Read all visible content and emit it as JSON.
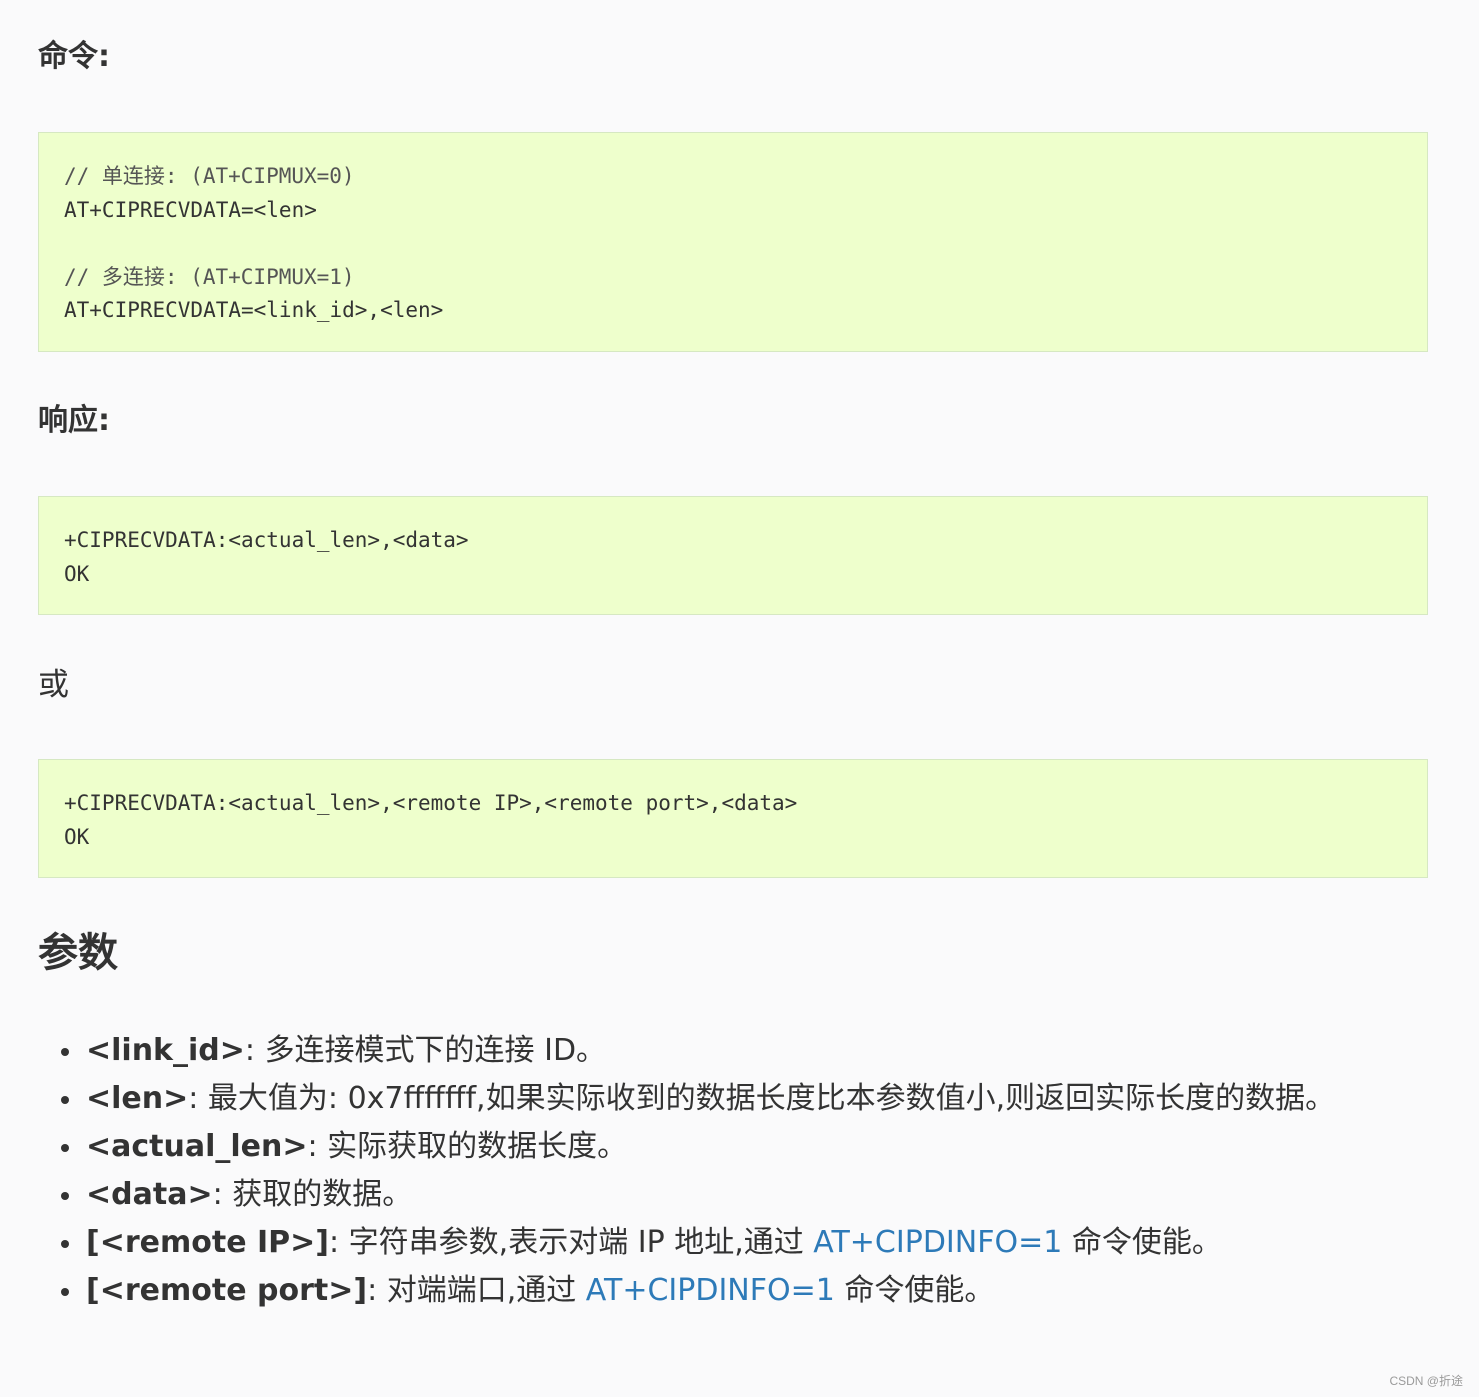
{
  "command": {
    "label": "命令:",
    "lines": [
      "// 单连接: (AT+CIPMUX=0)",
      "AT+CIPRECVDATA=<len>",
      "",
      "// 多连接: (AT+CIPMUX=1)",
      "AT+CIPRECVDATA=<link_id>,<len>"
    ]
  },
  "response": {
    "label": "响应:",
    "block1": [
      "+CIPRECVDATA:<actual_len>,<data>",
      "OK"
    ],
    "or_text": "或",
    "block2": [
      "+CIPRECVDATA:<actual_len>,<remote IP>,<remote port>,<data>",
      "OK"
    ]
  },
  "params": {
    "heading": "参数",
    "items": [
      {
        "name": "<link_id>",
        "sep": ": ",
        "desc": "多连接模式下的连接 ID。",
        "link": "",
        "after": ""
      },
      {
        "name": "<len>",
        "sep": ": ",
        "desc": "最大值为: 0x7fffffff,如果实际收到的数据长度比本参数值小,则返回实际长度的数据。",
        "link": "",
        "after": ""
      },
      {
        "name": "<actual_len>",
        "sep": ": ",
        "desc": "实际获取的数据长度。",
        "link": "",
        "after": ""
      },
      {
        "name": "<data>",
        "sep": ": ",
        "desc": "获取的数据。",
        "link": "",
        "after": ""
      },
      {
        "name": "[<remote IP>]",
        "sep": ": ",
        "desc": "字符串参数,表示对端 IP 地址,通过 ",
        "link": "AT+CIPDINFO=1",
        "after": " 命令使能。"
      },
      {
        "name": "[<remote port>]",
        "sep": ": ",
        "desc": "对端端口,通过 ",
        "link": "AT+CIPDINFO=1",
        "after": " 命令使能。"
      }
    ]
  },
  "watermark": "CSDN @折途"
}
